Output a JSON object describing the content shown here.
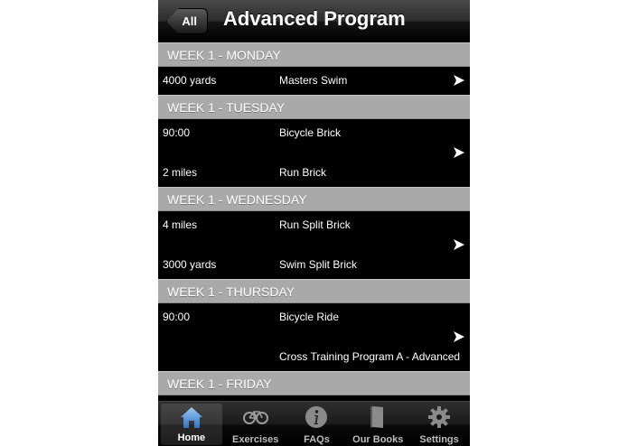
{
  "navbar": {
    "back_label": "All",
    "title": "Advanced Program"
  },
  "sections": [
    {
      "header": "WEEK 1 - MONDAY",
      "rows": [
        [
          "4000 yards",
          "Masters Swim"
        ]
      ]
    },
    {
      "header": "WEEK 1 - TUESDAY",
      "rows": [
        [
          "90:00",
          "Bicycle Brick"
        ],
        [
          "2 miles",
          "Run Brick"
        ]
      ]
    },
    {
      "header": "WEEK 1 - WEDNESDAY",
      "rows": [
        [
          "4 miles",
          "Run Split Brick"
        ],
        [
          "3000 yards",
          "Swim Split Brick"
        ]
      ]
    },
    {
      "header": "WEEK 1 - THURSDAY",
      "rows": [
        [
          "90:00",
          "Bicycle Ride"
        ],
        [
          "",
          "Cross Training Program A - Advanced"
        ]
      ]
    },
    {
      "header": "WEEK 1 - FRIDAY",
      "rows": []
    }
  ],
  "tabbar": {
    "tabs": [
      {
        "label": "Home",
        "icon": "home-icon",
        "active": true
      },
      {
        "label": "Exercises",
        "icon": "bicycle-icon"
      },
      {
        "label": "FAQs",
        "icon": "info-icon"
      },
      {
        "label": "Our Books",
        "icon": "book-icon"
      },
      {
        "label": "Settings",
        "icon": "gear-icon"
      }
    ]
  },
  "colors": {
    "section_header_bg": "#a9a9a9",
    "row_bg": "#000000",
    "home_icon_blue": "#4a90d9"
  }
}
